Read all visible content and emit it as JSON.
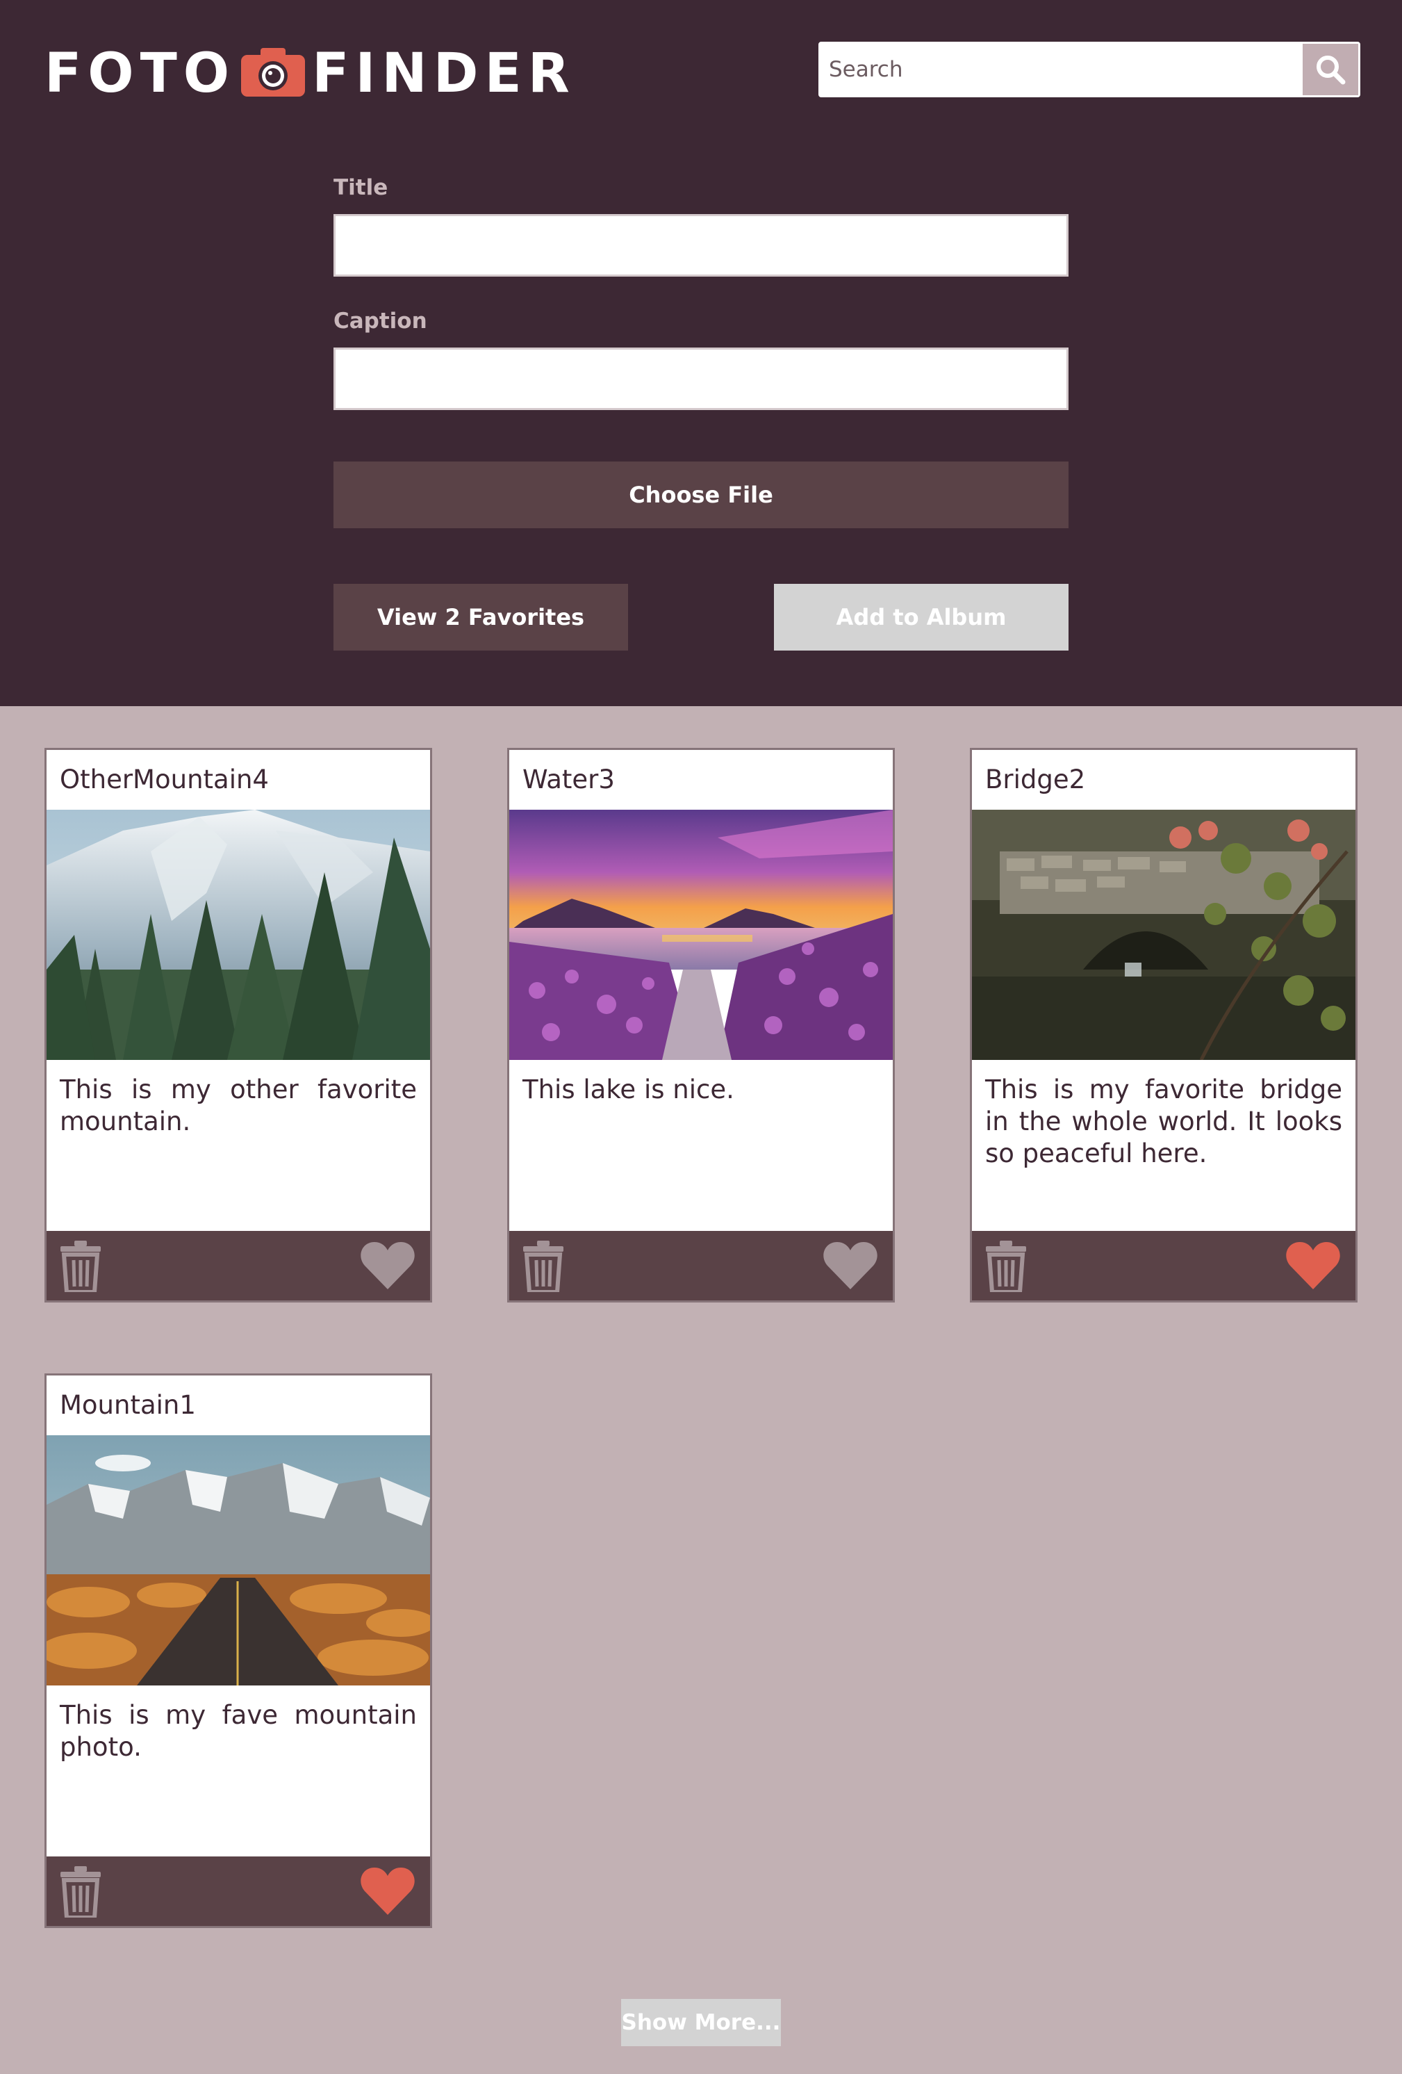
{
  "header": {
    "logo_left": "FOTO",
    "logo_right": "FINDER",
    "search": {
      "placeholder": "Search"
    }
  },
  "form": {
    "title_label": "Title",
    "caption_label": "Caption",
    "choose_file_label": "Choose File",
    "view_favorites_label": "View 2 Favorites",
    "add_to_album_label": "Add to Album"
  },
  "cards": [
    {
      "title": "OtherMountain4",
      "caption": "This is my other favorite mountain.",
      "favorited": false,
      "image": "mountain-forest"
    },
    {
      "title": "Water3",
      "caption": "This lake is nice.",
      "favorited": false,
      "image": "lake-sunset"
    },
    {
      "title": "Bridge2",
      "caption": "This is my favorite bridge in the whole world. It looks so peaceful here.",
      "favorited": true,
      "image": "stone-bridge"
    },
    {
      "title": "Mountain1",
      "caption": "This is my fave mountain photo.",
      "favorited": true,
      "image": "mountain-road"
    }
  ],
  "show_more_label": "Show More...",
  "colors": {
    "header_bg": "#3d2834",
    "page_bg": "#c2b1b4",
    "button_bg": "#5a4247",
    "disabled_bg": "#d3d3d3",
    "heart_active": "#e0604f",
    "heart_inactive": "#a39397",
    "icon_muted": "#a39397",
    "logo_camera": "#e0604f"
  },
  "icons": {
    "camera": "camera-icon",
    "search": "search-icon",
    "trash": "trash-icon",
    "heart": "heart-icon"
  }
}
